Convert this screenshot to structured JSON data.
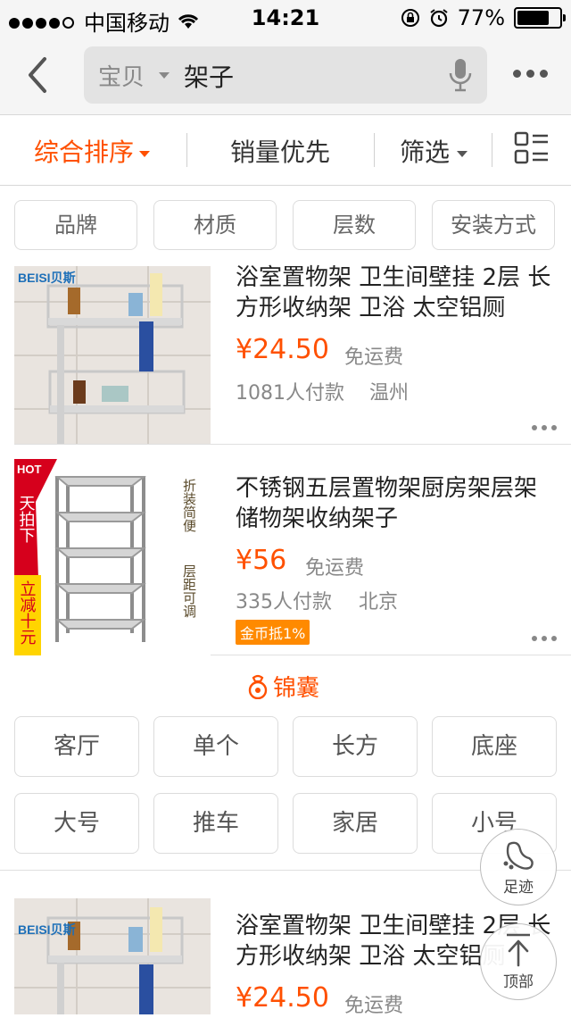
{
  "status": {
    "carrier": "中国移动",
    "time": "14:21",
    "battery": "77%",
    "battery_level": 0.77
  },
  "nav": {
    "scope": "宝贝",
    "query": "架子"
  },
  "sort": {
    "comprehensive": "综合排序",
    "sales": "销量优先",
    "filter": "筛选"
  },
  "filter_tags": [
    "品牌",
    "材质",
    "层数",
    "安装方式"
  ],
  "items": [
    {
      "title": "浴室置物架 卫生间壁挂 2层 长方形收纳架 卫浴 太空铝厕",
      "price": "¥24.50",
      "shipping": "免运费",
      "sold": "1081人付款",
      "location": "温州",
      "brand_mark": "BEISI贝斯"
    },
    {
      "title": "不锈钢五层置物架厨房架层架储物架收纳架子",
      "price": "¥56",
      "shipping": "免运费",
      "sold": "335人付款",
      "location": "北京",
      "badge": "金币抵1%",
      "promo_hot": "HOT",
      "promo_left": "天拍下",
      "promo_bottom": "立减十元",
      "promo_right1": "折装简便",
      "promo_right2": "层距可调"
    },
    {
      "title": "浴室置物架 卫生间壁挂 2层 长方形收纳架 卫浴 太空铝厕",
      "price": "¥24.50",
      "shipping": "免运费",
      "brand_mark": "BEISI贝斯"
    }
  ],
  "jinnang": {
    "label": "锦囊",
    "tags": [
      "客厅",
      "单个",
      "长方",
      "底座",
      "大号",
      "推车",
      "家居",
      "小号"
    ]
  },
  "float": {
    "footprint": "足迹",
    "top": "顶部"
  },
  "colors": {
    "accent": "#ff5000",
    "coin_badge": "#ff8a00"
  }
}
